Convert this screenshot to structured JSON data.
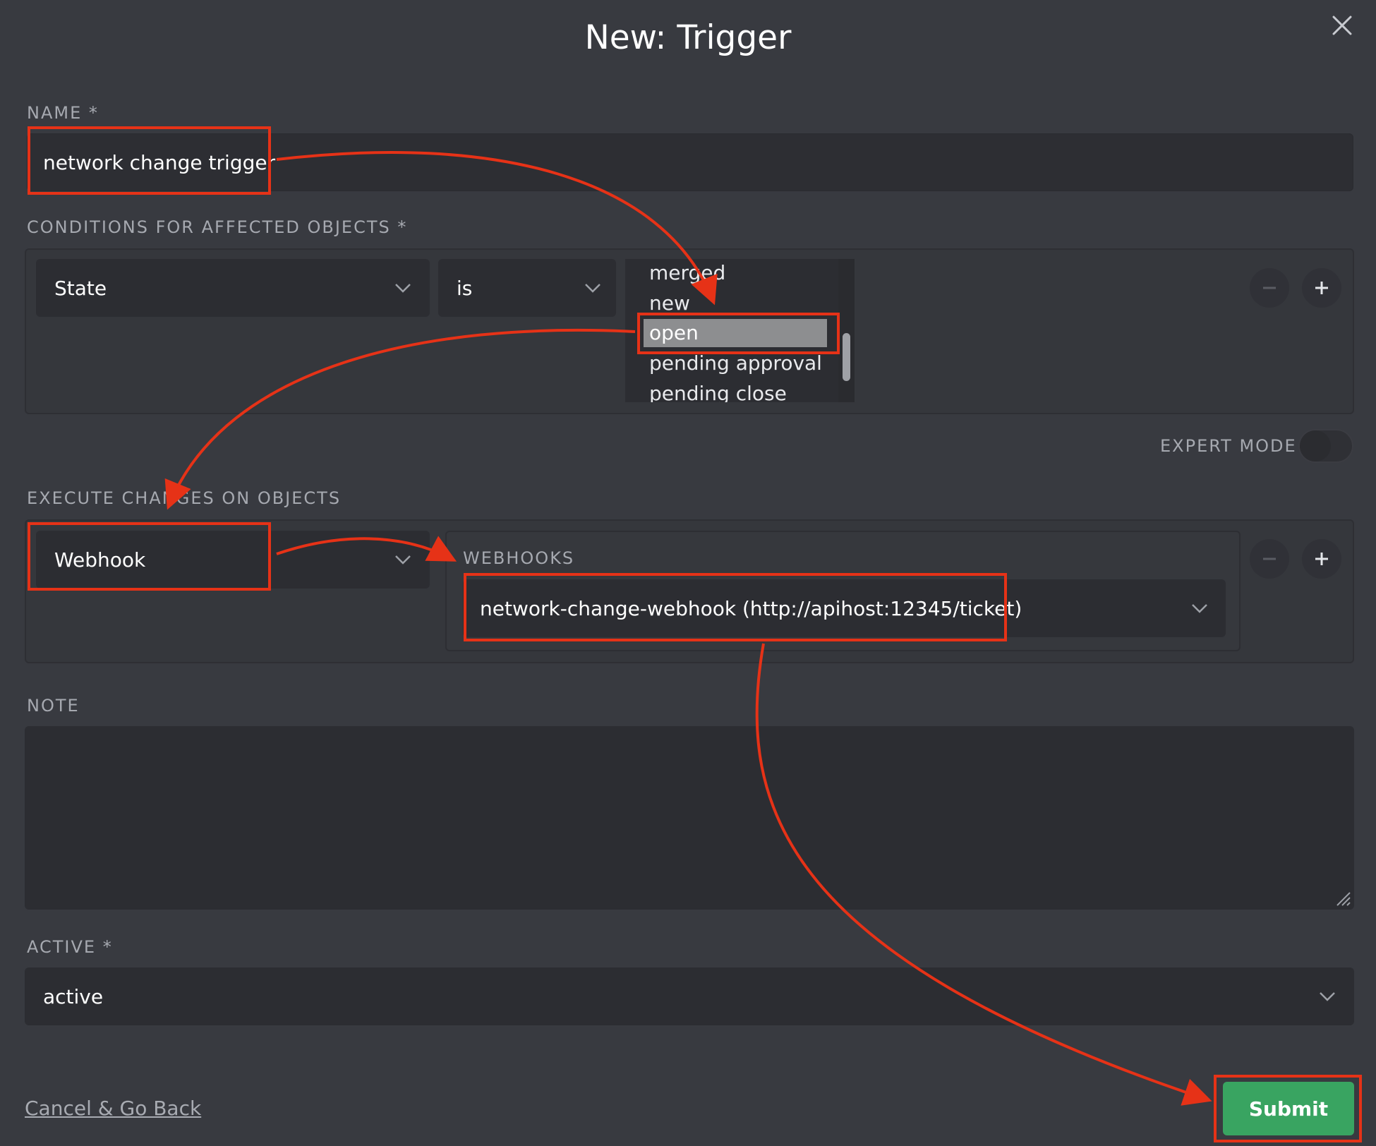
{
  "dialog": {
    "title": "New: Trigger"
  },
  "name_field": {
    "label": "NAME *",
    "value": "network change trigger"
  },
  "conditions": {
    "label": "CONDITIONS FOR AFFECTED OBJECTS *",
    "attribute": "State",
    "operator": "is",
    "options": [
      "merged",
      "new",
      "open",
      "pending approval",
      "pending close"
    ],
    "selected": "open"
  },
  "expert_mode": {
    "label": "EXPERT MODE",
    "enabled": false
  },
  "execute": {
    "label": "EXECUTE CHANGES ON OBJECTS",
    "action": "Webhook",
    "webhooks_label": "WEBHOOKS",
    "webhook_value": "network-change-webhook (http://apihost:12345/ticket)"
  },
  "note": {
    "label": "NOTE",
    "value": ""
  },
  "active": {
    "label": "ACTIVE *",
    "value": "active"
  },
  "actions": {
    "cancel_label": "Cancel & Go Back",
    "submit_label": "Submit"
  },
  "icons": {
    "close": "close-icon",
    "chevron": "chevron-down-icon",
    "minus": "minus-icon",
    "plus": "plus-icon"
  },
  "colors": {
    "background": "#383a40",
    "field": "#2d2e33",
    "submit": "#39a461",
    "annotation": "#e63217"
  }
}
